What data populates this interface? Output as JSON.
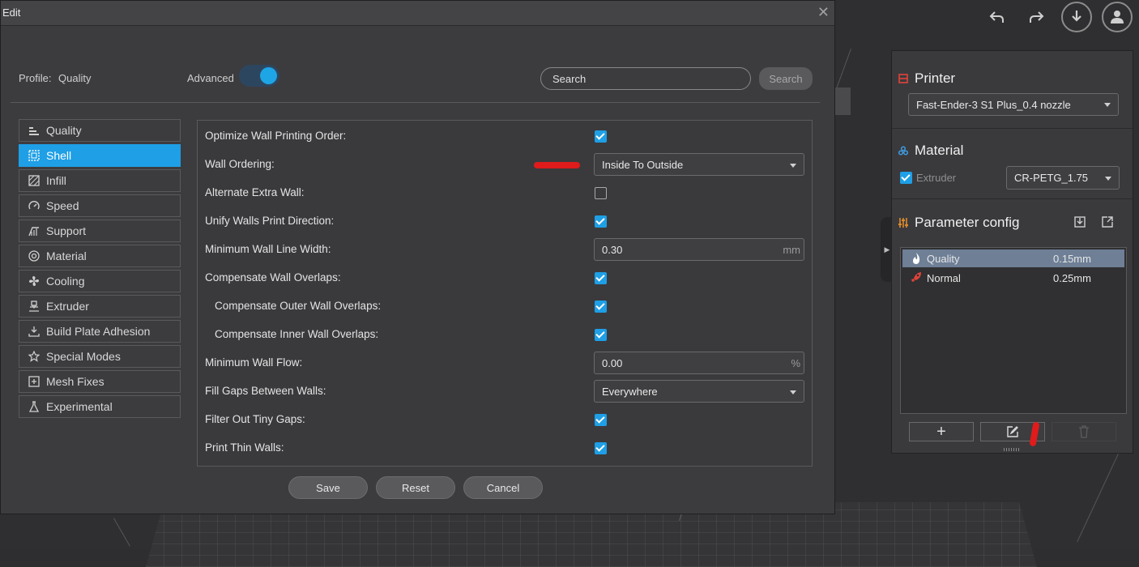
{
  "dialog": {
    "title": "Edit",
    "profile_label": "Profile:",
    "profile_value": "Quality",
    "advanced_label": "Advanced",
    "advanced_on": true,
    "search_placeholder": "Search",
    "search_button": "Search",
    "categories": [
      {
        "label": "Quality",
        "icon": "quality-icon"
      },
      {
        "label": "Shell",
        "icon": "shell-icon",
        "active": true
      },
      {
        "label": "Infill",
        "icon": "infill-icon"
      },
      {
        "label": "Speed",
        "icon": "speed-icon"
      },
      {
        "label": "Support",
        "icon": "support-icon"
      },
      {
        "label": "Material",
        "icon": "material-icon"
      },
      {
        "label": "Cooling",
        "icon": "fan-icon"
      },
      {
        "label": "Extruder",
        "icon": "extruder-icon"
      },
      {
        "label": "Build Plate Adhesion",
        "icon": "build-plate-icon"
      },
      {
        "label": "Special Modes",
        "icon": "star-icon"
      },
      {
        "label": "Mesh Fixes",
        "icon": "mesh-fixes-icon"
      },
      {
        "label": "Experimental",
        "icon": "flask-icon"
      }
    ],
    "settings": [
      {
        "label": "Optimize Wall Printing Order:",
        "type": "checkbox",
        "checked": true
      },
      {
        "label": "Wall Ordering:",
        "type": "select",
        "value": "Inside To Outside"
      },
      {
        "label": "Alternate Extra Wall:",
        "type": "checkbox",
        "checked": false
      },
      {
        "label": "Unify Walls Print Direction:",
        "type": "checkbox",
        "checked": true
      },
      {
        "label": "Minimum Wall Line Width:",
        "type": "number",
        "value": "0.30",
        "unit": "mm"
      },
      {
        "label": "Compensate Wall Overlaps:",
        "type": "checkbox",
        "checked": true
      },
      {
        "label": "Compensate Outer Wall Overlaps:",
        "type": "checkbox",
        "checked": true,
        "indent": true
      },
      {
        "label": "Compensate Inner Wall Overlaps:",
        "type": "checkbox",
        "checked": true,
        "indent": true
      },
      {
        "label": "Minimum Wall Flow:",
        "type": "number",
        "value": "0.00",
        "unit": "%"
      },
      {
        "label": "Fill Gaps Between Walls:",
        "type": "select",
        "value": "Everywhere"
      },
      {
        "label": "Filter Out Tiny Gaps:",
        "type": "checkbox",
        "checked": true
      },
      {
        "label": "Print Thin Walls:",
        "type": "checkbox",
        "checked": true
      }
    ],
    "buttons": {
      "save": "Save",
      "reset": "Reset",
      "cancel": "Cancel"
    }
  },
  "panel": {
    "printer_title": "Printer",
    "printer_value": "Fast-Ender-3 S1 Plus_0.4 nozzle",
    "material_title": "Material",
    "extruder_label": "Extruder",
    "extruder_checked": true,
    "material_value": "CR-PETG_1.75",
    "param_title": "Parameter config",
    "profiles": [
      {
        "name": "Quality",
        "layer": "0.15mm",
        "selected": true,
        "icon": "flame-icon"
      },
      {
        "name": "Normal",
        "layer": "0.25mm",
        "selected": false,
        "icon": "rocket-icon"
      }
    ],
    "add_label": "+"
  },
  "colors": {
    "accent": "#1e9fe6",
    "annotation": "#e01b1b"
  }
}
